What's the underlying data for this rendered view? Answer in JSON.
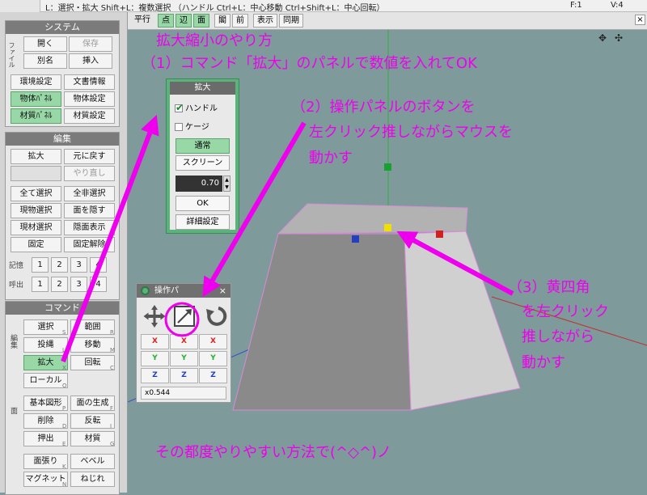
{
  "topbar": {
    "hint": "L：選択・拡大  Shift+L：複数選択  （ハンドル  Ctrl+L：中心移動  Ctrl+Shift+L：中心回転）",
    "frame": "F:1",
    "vertices": "V:4"
  },
  "left_panel": {
    "system": {
      "title": "システム",
      "file_label": "ファイル",
      "open": "開く",
      "save": "保存",
      "save_as": "別名",
      "insert": "挿入",
      "env_settings": "環境設定",
      "doc_info": "文書情報",
      "object_panel": "物体ﾊﾟﾈﾙ",
      "object_settings": "物体設定",
      "material_panel": "材質ﾊﾟﾈﾙ",
      "material_settings": "材質設定"
    },
    "edit": {
      "title": "編集",
      "scale": "拡大",
      "undo": "元に戻す",
      "redo": "やり直し",
      "select_all": "全て選択",
      "deselect_all": "全非選択",
      "select_current_object": "現物選択",
      "hide_face": "面を隠す",
      "select_current_material": "現材選択",
      "show_hidden": "隠面表示",
      "fix": "固定",
      "unfix": "固定解除",
      "memory_label": "記憶",
      "recall_label": "呼出",
      "slots": [
        "1",
        "2",
        "3",
        "4"
      ]
    },
    "command": {
      "title": "コマンド",
      "edit_label": "編集",
      "select": "選択",
      "select_key": "S",
      "range": "範囲",
      "range_key": "R",
      "project": "投縄",
      "project_key": "L",
      "move": "移動",
      "move_key": "M",
      "scale": "拡大",
      "scale_key": "X",
      "rotate": "回転",
      "rotate_key": "C",
      "local": "ローカル",
      "local_key": "O",
      "face_label": "面",
      "basic_shape": "基本図形",
      "basic_shape_key": "P",
      "face_gen": "面の生成",
      "face_gen_key": "F",
      "delete": "削除",
      "delete_key": "D",
      "flip": "反転",
      "flip_key": "I",
      "extrude": "押出",
      "extrude_key": "E",
      "material": "材質",
      "material_key": "G",
      "face_stretch": "面張り",
      "face_stretch_key": "K",
      "bevel": "ベベル",
      "magnet": "マグネット",
      "magnet_key": "N",
      "twist": "ねじれ"
    }
  },
  "toolbar": {
    "parallel": "平行",
    "point": "点",
    "edge": "辺",
    "face": "面",
    "hide": "閣",
    "front": "前",
    "display": "表示",
    "sync": "同期",
    "close": "×"
  },
  "scale_panel": {
    "title": "拡大",
    "handle": "ハンドル",
    "handle_checked": true,
    "cage": "ケージ",
    "cage_checked": false,
    "normal": "通常",
    "screen": "スクリーン",
    "value": "0.70",
    "ok": "OK",
    "detail": "詳細設定"
  },
  "operation_panel": {
    "title": "操作パ",
    "close": "×",
    "axes": [
      "X",
      "Y",
      "Z"
    ],
    "scale_readout": "x0.544"
  },
  "annotations": {
    "title": "拡大縮小のやり方",
    "step1": "（1）コマンド「拡大」のパネルで数値を入れてOK",
    "step2_line1": "（2）操作パネルのボタンを",
    "step2_line2": "左クリック推しながらマウスを",
    "step2_line3": "動かす",
    "step3_line1": "（3）黄四角",
    "step3_line2": "を左クリック",
    "step3_line3": "推しながら",
    "step3_line4": "動かす",
    "footer": "その都度やりやすい方法で(^◇^)ノ"
  },
  "colors": {
    "annotation": "#ee00ee",
    "viewport": "#7e9a9a",
    "active_green": "#98d7a6",
    "panel_green": "#5bb27a",
    "axis_x": "#e02020",
    "axis_y": "#20b030",
    "axis_z": "#2040c0"
  },
  "icons": [
    "move-cross-icon",
    "scale-diagonal-icon",
    "rotate-icon",
    "viewport-move-icon",
    "viewport-rotate-icon"
  ]
}
